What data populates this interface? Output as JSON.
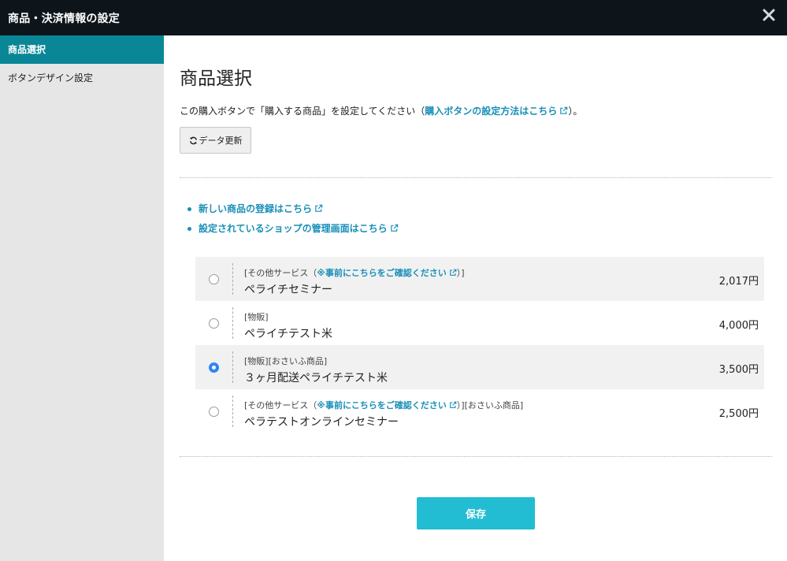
{
  "window": {
    "title": "商品・決済情報の設定",
    "close_icon": "close-icon"
  },
  "sidebar": {
    "items": [
      {
        "label": "商品選択",
        "active": true
      },
      {
        "label": "ボタンデザイン設定",
        "active": false
      }
    ]
  },
  "main": {
    "title": "商品選択",
    "description_prefix": "この購入ボタンで「購入する商品」を設定してください（",
    "description_link": "購入ボタンの設定方法はこちら",
    "description_suffix": "）。",
    "refresh_button": "データ更新",
    "links": [
      "新しい商品の登録はこちら",
      "設定されているショップの管理画面はこちら"
    ],
    "products": [
      {
        "tag_pre": "[その他サービス（",
        "tag_link": "※事前にこちらをご確認ください",
        "tag_post": "）]",
        "name": "ペライチセミナー",
        "price": "2,017円",
        "selected": false
      },
      {
        "tag_pre": "[物販]",
        "tag_link": "",
        "tag_post": "",
        "name": "ペライチテスト米",
        "price": "4,000円",
        "selected": false
      },
      {
        "tag_pre": "[物販][おさいふ商品]",
        "tag_link": "",
        "tag_post": "",
        "name": "３ヶ月配送ペライチテスト米",
        "price": "3,500円",
        "selected": true
      },
      {
        "tag_pre": "[その他サービス（",
        "tag_link": "※事前にこちらをご確認ください",
        "tag_post": "）][おさいふ商品]",
        "name": "ペラテストオンラインセミナー",
        "price": "2,500円",
        "selected": false
      }
    ],
    "save_button": "保存"
  },
  "colors": {
    "titlebar": "#0d151b",
    "sidebar_active": "#0a8796",
    "link": "#1a8fb8",
    "radio_selected": "#2f86f0",
    "save_button": "#22bdd2"
  }
}
